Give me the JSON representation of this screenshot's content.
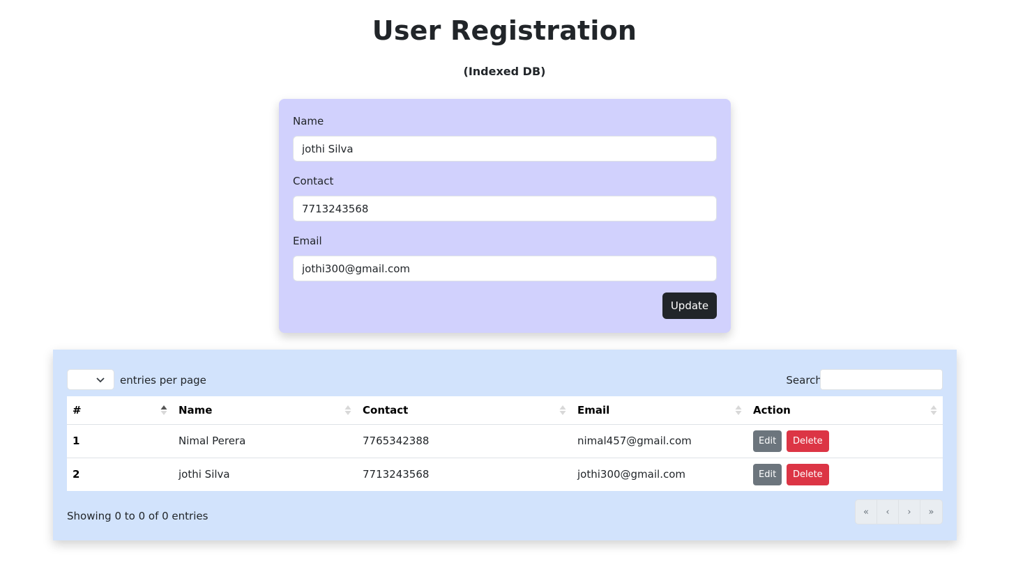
{
  "header": {
    "title": "User Registration",
    "subtitle": "(Indexed DB)"
  },
  "form": {
    "name_label": "Name",
    "name_value": "jothi Silva",
    "contact_label": "Contact",
    "contact_value": "7713243568",
    "email_label": "Email",
    "email_value": "jothi300@gmail.com",
    "submit_label": "Update"
  },
  "table": {
    "per_page_label": "entries per page",
    "search_label": "Search:",
    "columns": [
      "#",
      "Name",
      "Contact",
      "Email",
      "Action"
    ],
    "rows": [
      {
        "index": "1",
        "name": "Nimal Perera",
        "contact": "7765342388",
        "email": "nimal457@gmail.com"
      },
      {
        "index": "2",
        "name": "jothi Silva",
        "contact": "7713243568",
        "email": "jothi300@gmail.com"
      }
    ],
    "edit_label": "Edit",
    "delete_label": "Delete",
    "info": "Showing 0 to 0 of 0 entries",
    "pager": {
      "first": "«",
      "prev": "‹",
      "next": "›",
      "last": "»"
    }
  },
  "colors": {
    "form_bg": "#d1d1fd",
    "table_bg": "#d2e3fc",
    "update_btn": "#212529",
    "edit_btn": "#6c757d",
    "delete_btn": "#dc3545"
  }
}
